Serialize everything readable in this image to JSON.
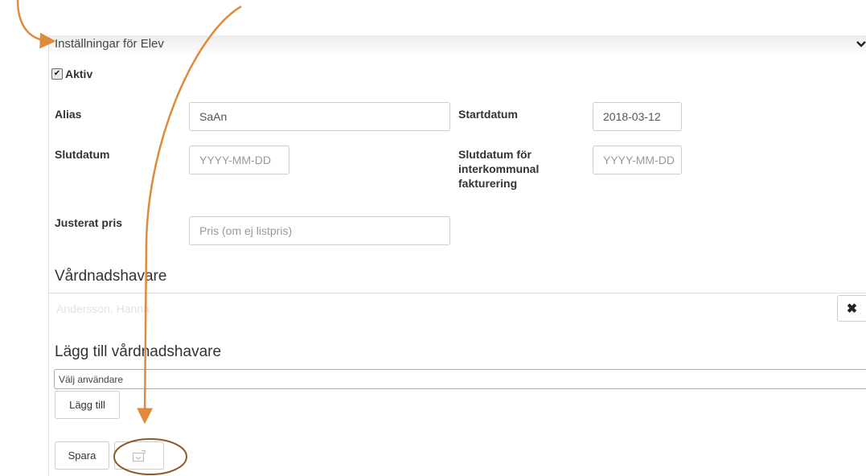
{
  "panel": {
    "title": "Inställningar för Elev"
  },
  "aktiv": {
    "label": "Aktiv",
    "checked": true
  },
  "fields": {
    "alias": {
      "label": "Alias",
      "value": "SaAn"
    },
    "startdatum": {
      "label": "Startdatum",
      "value": "2018-03-12"
    },
    "slutdatum": {
      "label": "Slutdatum",
      "placeholder": "YYYY-MM-DD"
    },
    "slutdatum_interkommunal": {
      "label_line1": "Slutdatum för",
      "label_line2": "interkommunal",
      "label_line3": "fakturering",
      "placeholder": "YYYY-MM-DD"
    },
    "justerat_pris": {
      "label": "Justerat pris",
      "placeholder": "Pris (om ej listpris)"
    }
  },
  "guardians": {
    "heading": "Vårdnadshavare",
    "items": [
      {
        "name": "Andersson, Hanna"
      }
    ],
    "remove_glyph": "✖"
  },
  "add_guardian": {
    "heading": "Lägg till vårdnadshavare",
    "select_value": "Välj användare",
    "add_button": "Lägg till"
  },
  "actions": {
    "save_button": "Spara"
  },
  "icons": {
    "chevron": "chevron-down-icon",
    "checkmark": "checkmark-icon",
    "remove": "close-icon",
    "export": "export-icon"
  },
  "colors": {
    "annotation_arrow": "#E08A3C",
    "annotation_circle": "#8B5A2B"
  }
}
